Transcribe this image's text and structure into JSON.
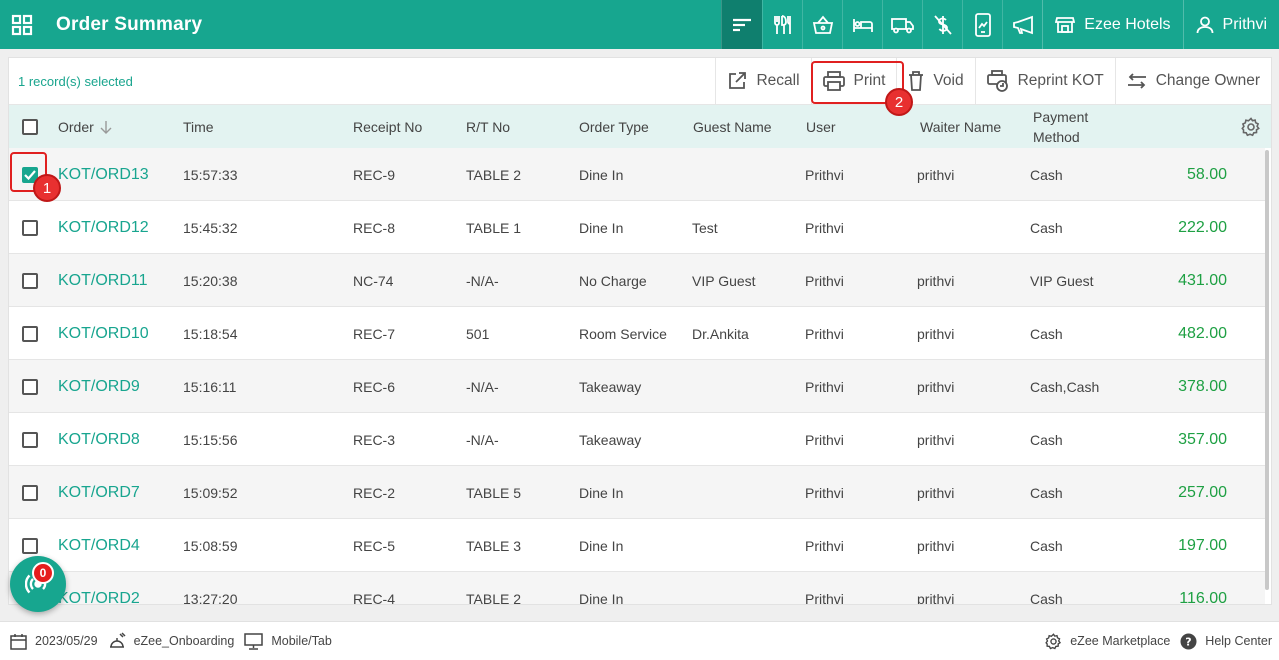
{
  "header": {
    "title": "Order Summary",
    "property": "Ezee Hotels",
    "user": "Prithvi",
    "colors": {
      "brand": "#17a68f",
      "active": "#0f7f6e"
    },
    "icons": [
      "menu-icon",
      "restaurant-icon",
      "basket-icon",
      "room-icon",
      "delivery-truck-icon",
      "no-charge-icon",
      "mobile-order-icon",
      "announcement-icon",
      "store-icon",
      "user-icon"
    ]
  },
  "actionbar": {
    "selection": "1 record(s) selected",
    "recall": "Recall",
    "print": "Print",
    "void": "Void",
    "reprint": "Reprint KOT",
    "change_owner": "Change Owner"
  },
  "table": {
    "headers": {
      "order": "Order",
      "time": "Time",
      "receipt": "Receipt No",
      "rt": "R/T No",
      "type": "Order Type",
      "guest": "Guest Name",
      "user": "User",
      "waiter": "Waiter Name",
      "payment_line1": "Payment",
      "payment_line2": "Method"
    },
    "rows": [
      {
        "order": "KOT/ORD13",
        "time": "15:57:33",
        "receipt": "REC-9",
        "rt": "TABLE 2",
        "type": "Dine In",
        "guest": "",
        "user": "Prithvi",
        "waiter": "prithvi",
        "payment": "Cash",
        "amount": "58.00",
        "checked": true
      },
      {
        "order": "KOT/ORD12",
        "time": "15:45:32",
        "receipt": "REC-8",
        "rt": "TABLE 1",
        "type": "Dine In",
        "guest": "Test",
        "user": "Prithvi",
        "waiter": "",
        "payment": "Cash",
        "amount": "222.00",
        "checked": false
      },
      {
        "order": "KOT/ORD11",
        "time": "15:20:38",
        "receipt": "NC-74",
        "rt": "-N/A-",
        "type": "No Charge",
        "guest": "VIP Guest",
        "user": "Prithvi",
        "waiter": "prithvi",
        "payment": "VIP Guest",
        "amount": "431.00",
        "checked": false
      },
      {
        "order": "KOT/ORD10",
        "time": "15:18:54",
        "receipt": "REC-7",
        "rt": "501",
        "type": "Room Service",
        "guest": "Dr.Ankita",
        "user": "Prithvi",
        "waiter": "prithvi",
        "payment": "Cash",
        "amount": "482.00",
        "checked": false
      },
      {
        "order": "KOT/ORD9",
        "time": "15:16:11",
        "receipt": "REC-6",
        "rt": "-N/A-",
        "type": "Takeaway",
        "guest": "",
        "user": "Prithvi",
        "waiter": "prithvi",
        "payment": "Cash,Cash",
        "amount": "378.00",
        "checked": false
      },
      {
        "order": "KOT/ORD8",
        "time": "15:15:56",
        "receipt": "REC-3",
        "rt": "-N/A-",
        "type": "Takeaway",
        "guest": "",
        "user": "Prithvi",
        "waiter": "prithvi",
        "payment": "Cash",
        "amount": "357.00",
        "checked": false
      },
      {
        "order": "KOT/ORD7",
        "time": "15:09:52",
        "receipt": "REC-2",
        "rt": "TABLE 5",
        "type": "Dine In",
        "guest": "",
        "user": "Prithvi",
        "waiter": "prithvi",
        "payment": "Cash",
        "amount": "257.00",
        "checked": false
      },
      {
        "order": "KOT/ORD4",
        "time": "15:08:59",
        "receipt": "REC-5",
        "rt": "TABLE 3",
        "type": "Dine In",
        "guest": "",
        "user": "Prithvi",
        "waiter": "prithvi",
        "payment": "Cash",
        "amount": "197.00",
        "checked": false
      },
      {
        "order": "KOT/ORD2",
        "time": "13:27:20",
        "receipt": "REC-4",
        "rt": "TABLE 2",
        "type": "Dine In",
        "guest": "",
        "user": "Prithvi",
        "waiter": "prithvi",
        "payment": "Cash",
        "amount": "116.00",
        "checked": false
      }
    ]
  },
  "annotations": {
    "step1": "1",
    "step2": "2",
    "color": "#e02020"
  },
  "fab": {
    "count": "0"
  },
  "footer": {
    "date": "2023/05/29",
    "outlet": "eZee_Onboarding",
    "device": "Mobile/Tab",
    "marketplace": "eZee Marketplace",
    "help": "Help Center"
  }
}
